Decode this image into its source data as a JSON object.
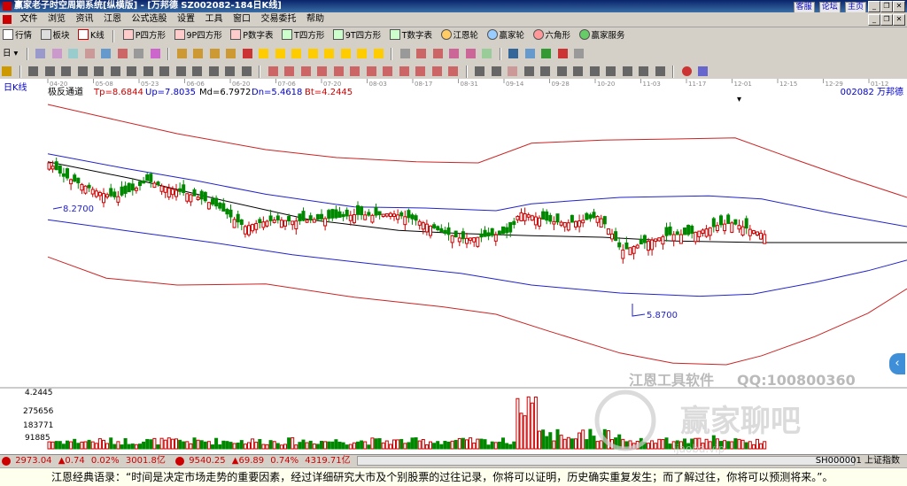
{
  "window": {
    "title": "赢家老子时空周期系统[纵横版] - [万邦德  SZ002082-184日K线]",
    "links": [
      "客服",
      "论坛",
      "主页"
    ]
  },
  "menu": {
    "items": [
      "文件",
      "浏览",
      "资讯",
      "江恩",
      "公式选股",
      "设置",
      "工具",
      "窗口",
      "交易委托",
      "帮助"
    ]
  },
  "toolbar1": {
    "items": [
      "行情",
      "板块",
      "K线",
      "P四方形",
      "9P四方形",
      "P数字表",
      "T四方形",
      "9T四方形",
      "T数字表",
      "江恩轮",
      "赢家轮",
      "六角形",
      "赢家服务"
    ]
  },
  "toolbar2": {
    "period": "日"
  },
  "chart": {
    "period_label": "日K线",
    "indicator_name": "极反通道",
    "tp": "Tp=8.6844",
    "up": "Up=7.8035",
    "md": "Md=6.7972",
    "dn": "Dn=5.4618",
    "bt": "Bt=4.2445",
    "stock": "002082 万邦德",
    "dates": [
      "04-20",
      "05-08",
      "05-23",
      "06-06",
      "06-20",
      "07-06",
      "07-20",
      "08-03",
      "08-17",
      "08-31",
      "09-14",
      "09-28",
      "10-20",
      "11-03",
      "11-17",
      "12-01",
      "12-15",
      "12-29",
      "01-12"
    ],
    "annot_high": "8.2700",
    "annot_low": "5.8700",
    "vol_ticks": [
      "4.2445",
      "275656",
      "183771",
      "91885"
    ],
    "watermark1": "江恩工具软件",
    "watermark2": "QQ:100800360",
    "watermark3": "赢家聊吧",
    "watermark4": "ijaoba.vip"
  },
  "status": {
    "sh_index": "2973.04",
    "sh_change": "▲0.74",
    "sh_pct": "0.02%",
    "sh_amount": "3001.8亿",
    "sz_index": "9540.25",
    "sz_change": "▲69.89",
    "sz_pct": "0.74%",
    "sz_amount": "4319.71亿",
    "right": "SH000001 上证指数"
  },
  "quote": {
    "text": "江恩经典语录：“时间是决定市场走势的重要因素，经过详细研究大市及个别股票的过往记录，你将可以证明，历史确实重复发生；而了解过往，你将可以预测将来。”。"
  },
  "colors": {
    "up": "#cc0000",
    "down": "#008800",
    "band_outer": "#cc2222",
    "band_inner": "#2222cc",
    "mid": "#000000"
  }
}
